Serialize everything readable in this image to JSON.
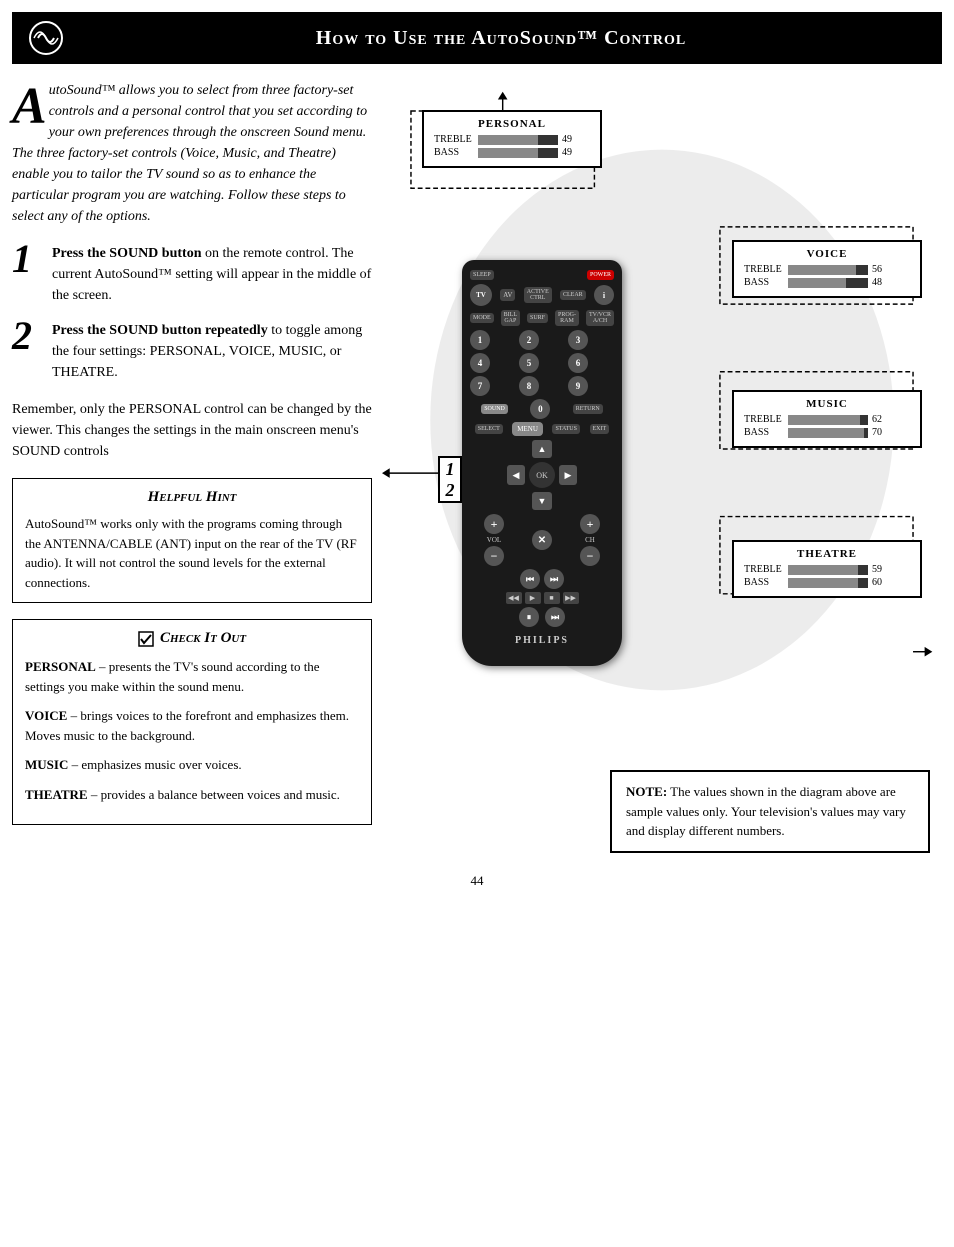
{
  "header": {
    "title": "How to Use the AutoSound™ Control"
  },
  "intro": {
    "drop_cap": "A",
    "text": "utoSound™ allows you to select from three factory-set controls and a personal control that you set according to your own preferences through the onscreen Sound menu. The three factory-set controls (Voice, Music, and Theatre) enable you to tailor the TV sound so as to enhance the particular program you are watching. Follow these steps to select any of the options."
  },
  "steps": [
    {
      "num": "1",
      "bold_text": "Press the SOUND button",
      "rest_text": " on the remote control. The current AutoSound™ setting will appear in the middle of the screen."
    },
    {
      "num": "2",
      "bold_text": "Press the SOUND button repeatedly",
      "rest_text": " to toggle among the four settings: PERSONAL, VOICE, MUSIC, or THEATRE."
    }
  ],
  "reminder": "Remember, only the PERSONAL control can be changed by the viewer. This changes the settings in the main onscreen menu's SOUND controls",
  "hint": {
    "title": "Helpful Hint",
    "text": "AutoSound™ works only with the programs coming through the ANTENNA/CABLE (ANT) input on the rear of the TV (RF audio). It will not control the sound levels for the external connections."
  },
  "check": {
    "title": "Check It Out",
    "entries": [
      {
        "label": "PERSONAL",
        "text": " – presents the TV's sound according to the settings you make within the sound menu."
      },
      {
        "label": "VOICE",
        "text": " – brings voices to the forefront and emphasizes them. Moves music to the background."
      },
      {
        "label": "MUSIC",
        "text": " – emphasizes music over voices."
      },
      {
        "label": "THEATRE",
        "text": " – provides a balance between voices and music."
      }
    ]
  },
  "panels": {
    "personal": {
      "title": "PERSONAL",
      "treble_value": "49",
      "bass_value": "49",
      "treble_pct": 75,
      "bass_pct": 75
    },
    "voice": {
      "title": "VOICE",
      "treble_value": "56",
      "bass_value": "48",
      "treble_pct": 85,
      "bass_pct": 72
    },
    "music": {
      "title": "MUSIC",
      "treble_value": "62",
      "bass_value": "70",
      "treble_pct": 90,
      "bass_pct": 95
    },
    "theatre": {
      "title": "THEATRE",
      "treble_value": "59",
      "bass_value": "60",
      "treble_pct": 88,
      "bass_pct": 88
    }
  },
  "note": {
    "label": "NOTE:",
    "text": " The values shown in the diagram above are sample values only. Your television's values may vary and display different numbers."
  },
  "page_number": "44",
  "remote": {
    "brand": "PHILIPS",
    "step_labels": [
      "1",
      "2"
    ]
  }
}
